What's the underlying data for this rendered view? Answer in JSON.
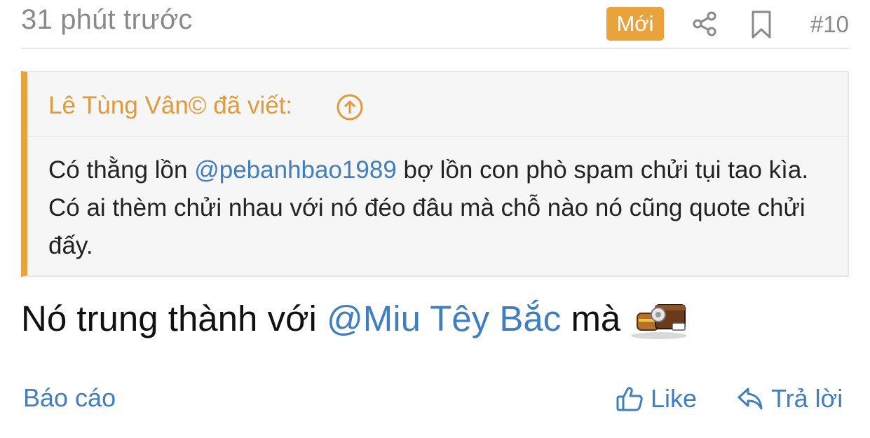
{
  "post": {
    "timestamp": "31 phút trước",
    "badge": "Mới",
    "number": "#10",
    "quote": {
      "author_line": "Lê Tùng Vân© đã viết:",
      "text_before": "Có thằng lồn ",
      "mention": "@pebanhbao1989",
      "text_after": " bợ lồn con phò spam chửi tụi tao kìa. Có ai thèm chửi nhau với nó đéo đâu mà chỗ nào nó cũng quote chửi đấy."
    },
    "body": {
      "text_before": "Nó trung thành với ",
      "mention": "@Miu Têy Bắc",
      "text_after": " mà"
    },
    "emoji": "treasure-emoji",
    "actions": {
      "report": "Báo cáo",
      "like": "Like",
      "reply": "Trả lời"
    }
  },
  "colors": {
    "accent": "#e8a33d",
    "link": "#3f7fc0",
    "muted": "#8a8a8a"
  },
  "icons": {
    "share": "share-icon",
    "bookmark": "bookmark-icon",
    "quote_jump": "arrow-up-circle-icon",
    "like": "thumbs-up-icon",
    "reply": "reply-arrow-icon"
  }
}
